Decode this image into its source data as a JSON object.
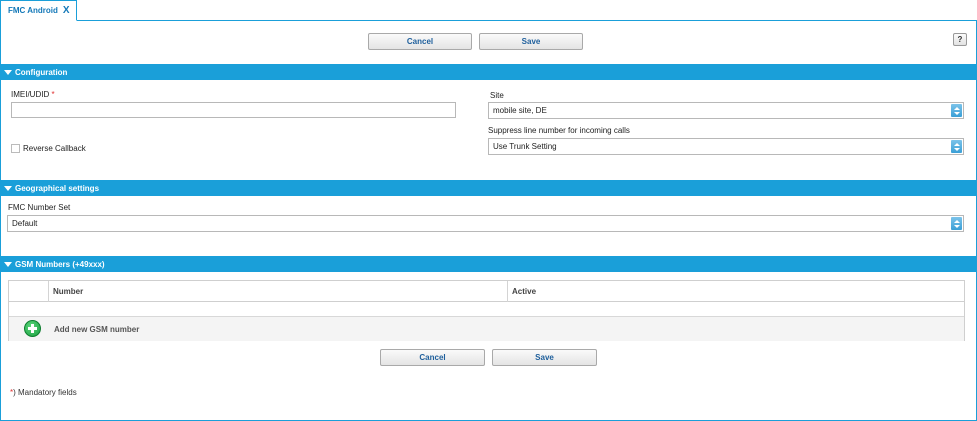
{
  "tab": {
    "title": "FMC Android",
    "close": "X"
  },
  "toolbar": {
    "cancel_label": "Cancel",
    "save_label": "Save",
    "help_label": "?"
  },
  "configuration": {
    "header": "Configuration",
    "imei_label": "IMEI/UDID",
    "required_marker": "*",
    "imei_value": "",
    "site_label": "Site",
    "site_value": "mobile site, DE",
    "suppress_label": "Suppress line number for incoming calls",
    "suppress_value": "Use Trunk Setting",
    "reverse_callback_label": "Reverse Callback",
    "reverse_callback_checked": false
  },
  "geographical": {
    "header": "Geographical settings",
    "number_set_label": "FMC Number Set",
    "number_set_value": "Default"
  },
  "gsm": {
    "header": "GSM Numbers (+49xxx)",
    "columns": [
      "Number",
      "Active"
    ],
    "rows": [],
    "add_label": "Add new GSM number"
  },
  "footer": {
    "cancel_label": "Cancel",
    "save_label": "Save",
    "mandatory_marker": "*",
    "mandatory_text": ") Mandatory fields"
  },
  "colors": {
    "accent": "#1a9fd9",
    "link": "#1378b8",
    "required": "#e03030",
    "add_green": "#17a03f"
  },
  "icons": {
    "tab_close": "close-icon",
    "collapse": "triangle-down-icon",
    "spinner": "spinner-icon",
    "add": "plus-circle-icon"
  }
}
